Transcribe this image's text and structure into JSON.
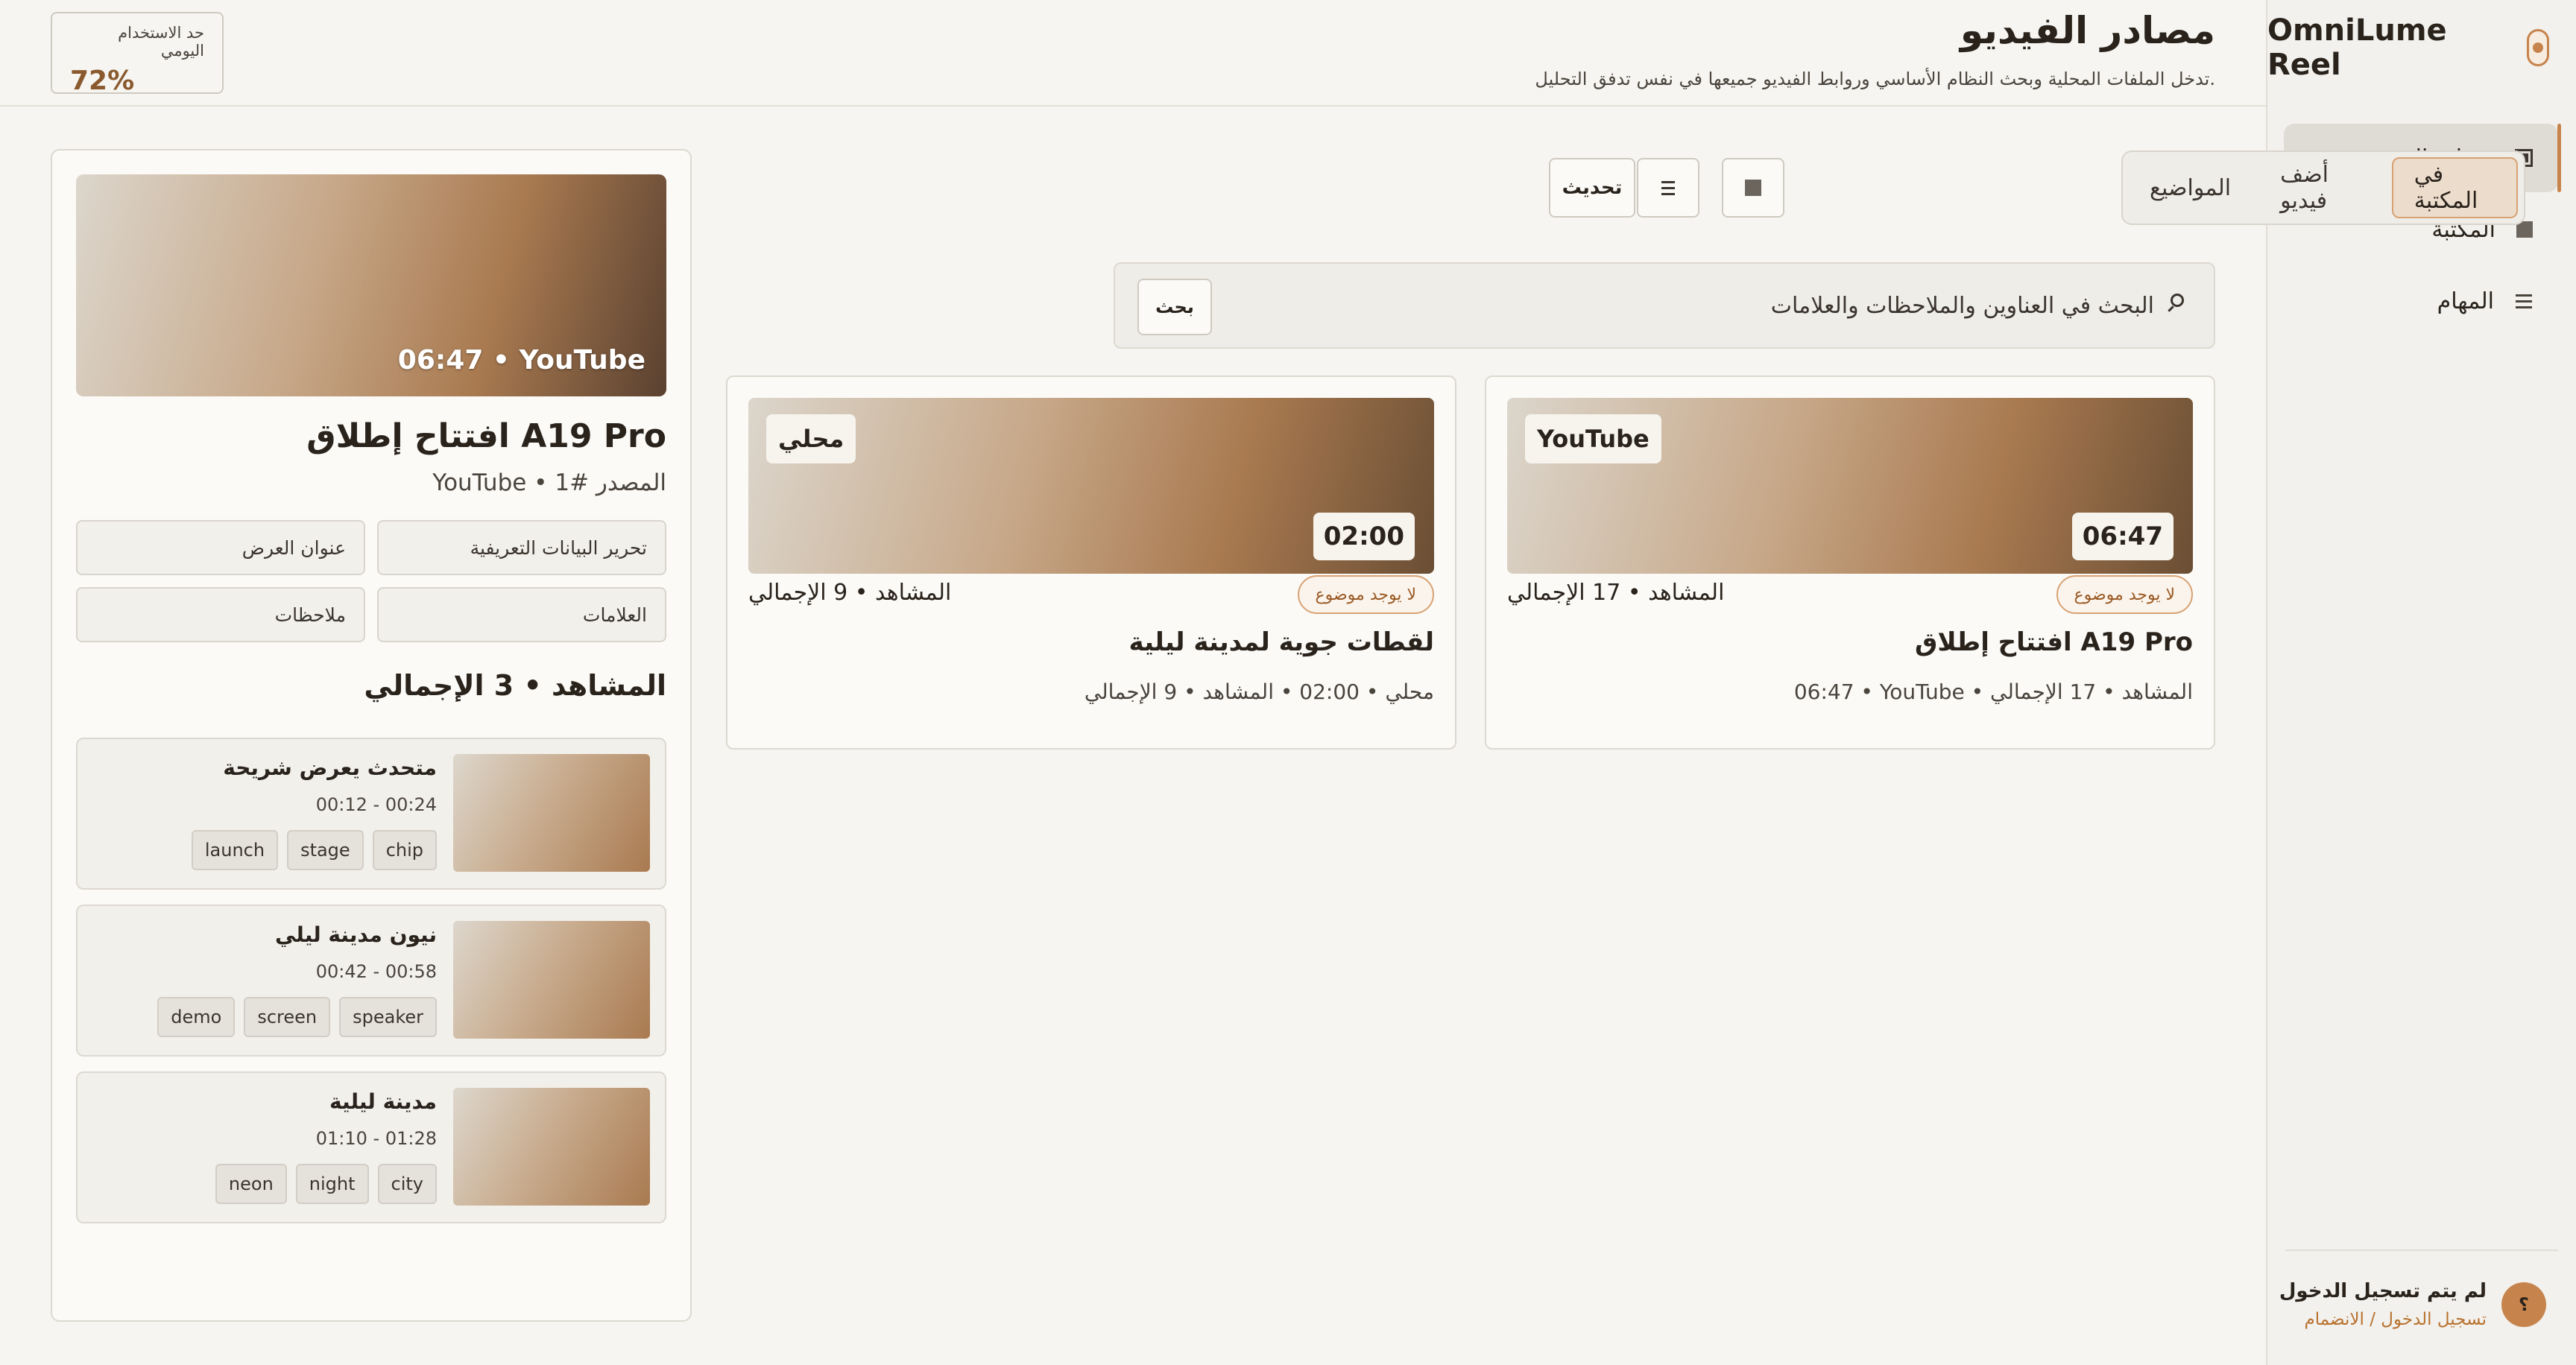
{
  "app": {
    "name": "OmniLume Reel"
  },
  "sidebar": {
    "items": [
      {
        "label": "مصادر الفيديو",
        "icon": "square-outline-icon",
        "active": true
      },
      {
        "label": "المكتبة",
        "icon": "square-icon",
        "active": false
      },
      {
        "label": "المهام",
        "icon": "list-icon",
        "active": false
      }
    ],
    "user": {
      "avatar": "؟",
      "name": "لم يتم تسجيل الدخول",
      "link": "تسجيل الدخول / الانضمام"
    }
  },
  "header": {
    "title": "مصادر الفيديو",
    "subtitle": "تدخل الملفات المحلية وبحث النظام الأساسي وروابط الفيديو جميعها في نفس تدفق التحليل.",
    "quota_label": "حد الاستخدام اليومي",
    "quota_value": "72%"
  },
  "toolbar": {
    "tabs": [
      "في المكتبة",
      "أضف فيديو",
      "المواضيع"
    ],
    "active_tab": "في المكتبة",
    "refresh_label": "تحديث",
    "search_placeholder": "البحث في العناوين والملاحظات والعلامات",
    "search_button": "بحث"
  },
  "cards": [
    {
      "source": "YouTube",
      "duration": "06:47",
      "topic": "لا يوجد موضوع",
      "scenes": "المشاهد • 17 الإجمالي",
      "title": "افتتاح إطلاق A19 Pro",
      "meta": "06:47 • YouTube • المشاهد • 17 الإجمالي"
    },
    {
      "source": "محلي",
      "duration": "02:00",
      "topic": "لا يوجد موضوع",
      "scenes": "المشاهد • 9 الإجمالي",
      "title": "لقطات جوية لمدينة ليلية",
      "meta": "محلي • 02:00 • المشاهد • 9 الإجمالي"
    }
  ],
  "details": {
    "thumb_label": "06:47 • YouTube",
    "title": "افتتاح إطلاق A19 Pro",
    "subtitle": "YouTube • المصدر #1",
    "buttons": [
      "تحرير البيانات التعريفية",
      "عنوان العرض",
      "العلامات",
      "ملاحظات"
    ],
    "scenes_title": "المشاهد • 3 الإجمالي",
    "scenes": [
      {
        "title": "متحدث يعرض شريحة",
        "time": "00:12 - 00:24",
        "tags": [
          "chip",
          "stage",
          "launch"
        ]
      },
      {
        "title": "نيون مدينة ليلي",
        "time": "00:42 - 00:58",
        "tags": [
          "speaker",
          "screen",
          "demo"
        ]
      },
      {
        "title": "مدينة ليلية",
        "time": "01:10 - 01:28",
        "tags": [
          "city",
          "night",
          "neon"
        ]
      }
    ]
  },
  "colors": {
    "accent": "#c7834c",
    "background": "#f6f5f1",
    "card": "#fbfaf7"
  }
}
